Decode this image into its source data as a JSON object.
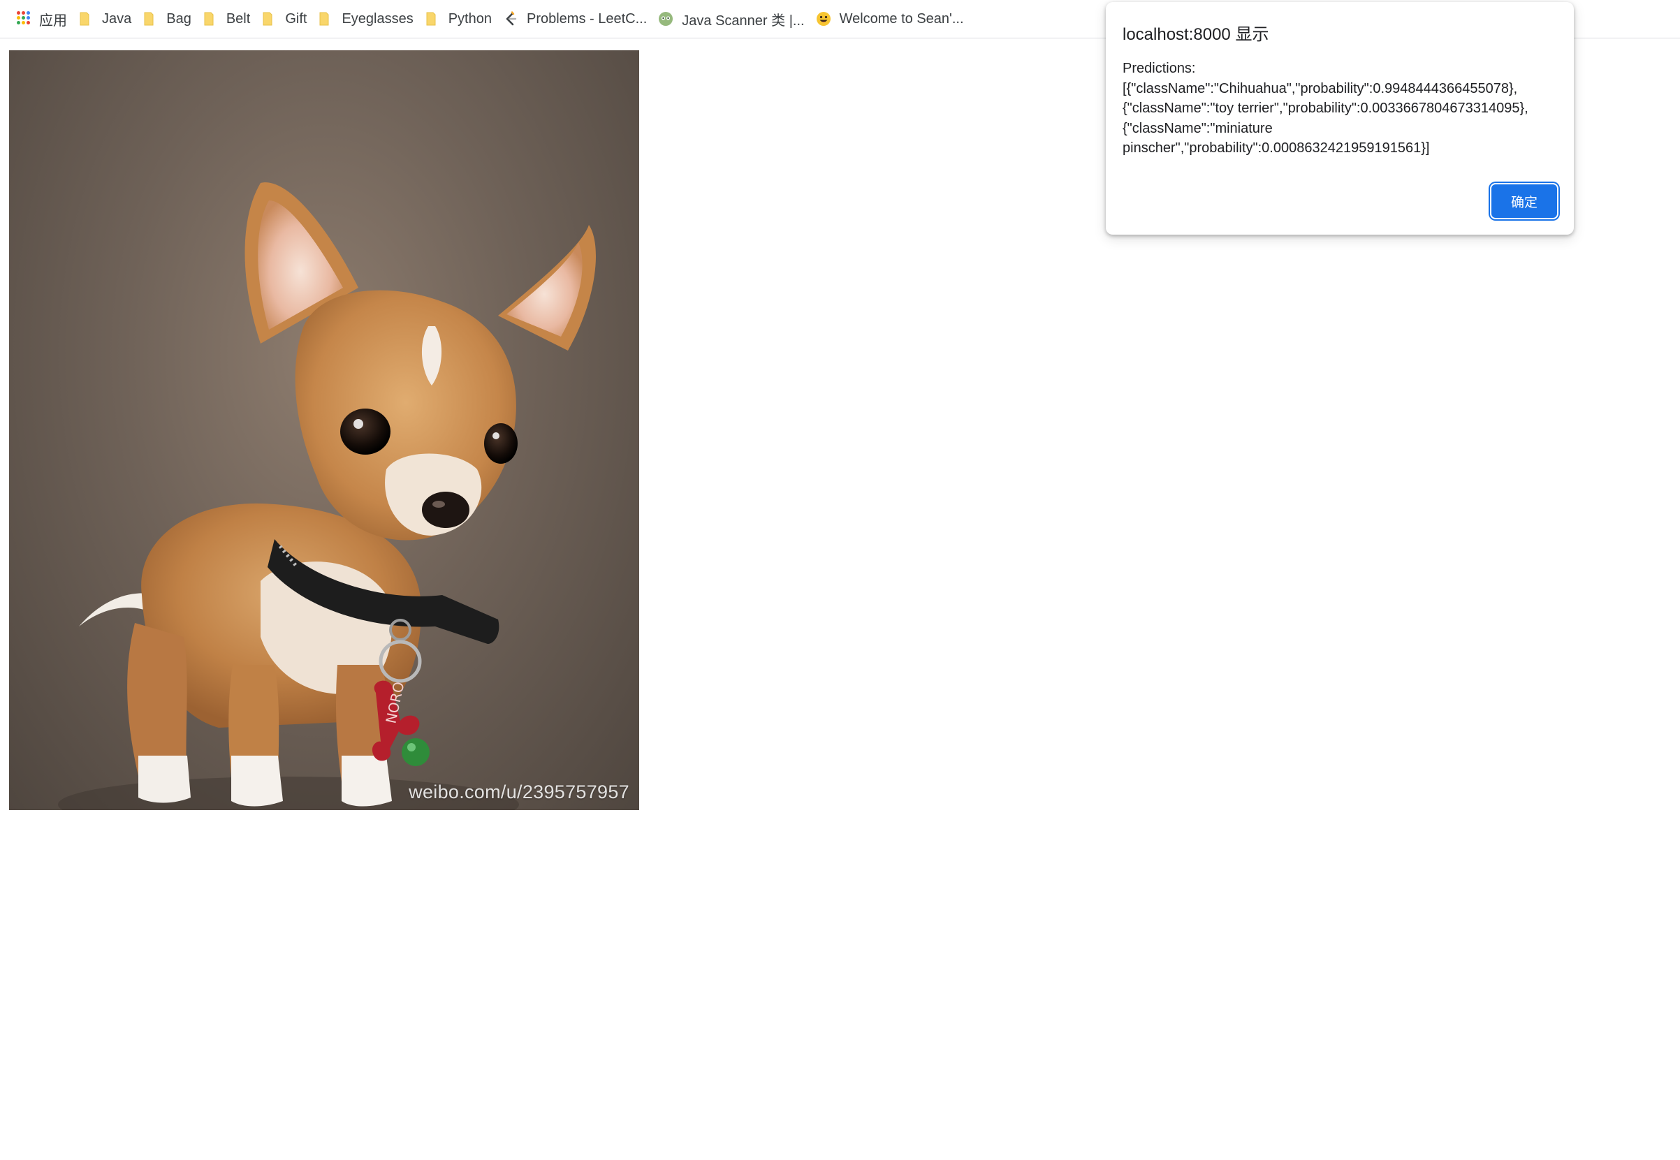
{
  "bookmarks": {
    "apps_label": "应用",
    "items": [
      {
        "label": "Java",
        "icon": "folder-icon"
      },
      {
        "label": "Bag",
        "icon": "folder-icon"
      },
      {
        "label": "Belt",
        "icon": "folder-icon"
      },
      {
        "label": "Gift",
        "icon": "folder-icon"
      },
      {
        "label": "Eyeglasses",
        "icon": "folder-icon"
      },
      {
        "label": "Python",
        "icon": "folder-icon"
      },
      {
        "label": "Problems - LeetC...",
        "icon": "leetcode-icon"
      },
      {
        "label": "Java Scanner 类 |...",
        "icon": "runoob-icon"
      },
      {
        "label": "Welcome to Sean'...",
        "icon": "emoji-icon"
      }
    ]
  },
  "photo": {
    "watermark": "weibo.com/u/2395757957",
    "tag_text": "NORO"
  },
  "dialog": {
    "title": "localhost:8000 显示",
    "message_lines": [
      "Predictions:",
      "[{\"className\":\"Chihuahua\",\"probability\":0.9948444366455078},",
      "{\"className\":\"toy terrier\",\"probability\":0.0033667804673314095},",
      "{\"className\":\"miniature",
      "pinscher\",\"probability\":0.0008632421959191561}]"
    ],
    "ok_label": "确定"
  },
  "colors": {
    "accent": "#1a73e8",
    "folder": "#f9d66b",
    "bookmark_text": "#3c4043"
  }
}
